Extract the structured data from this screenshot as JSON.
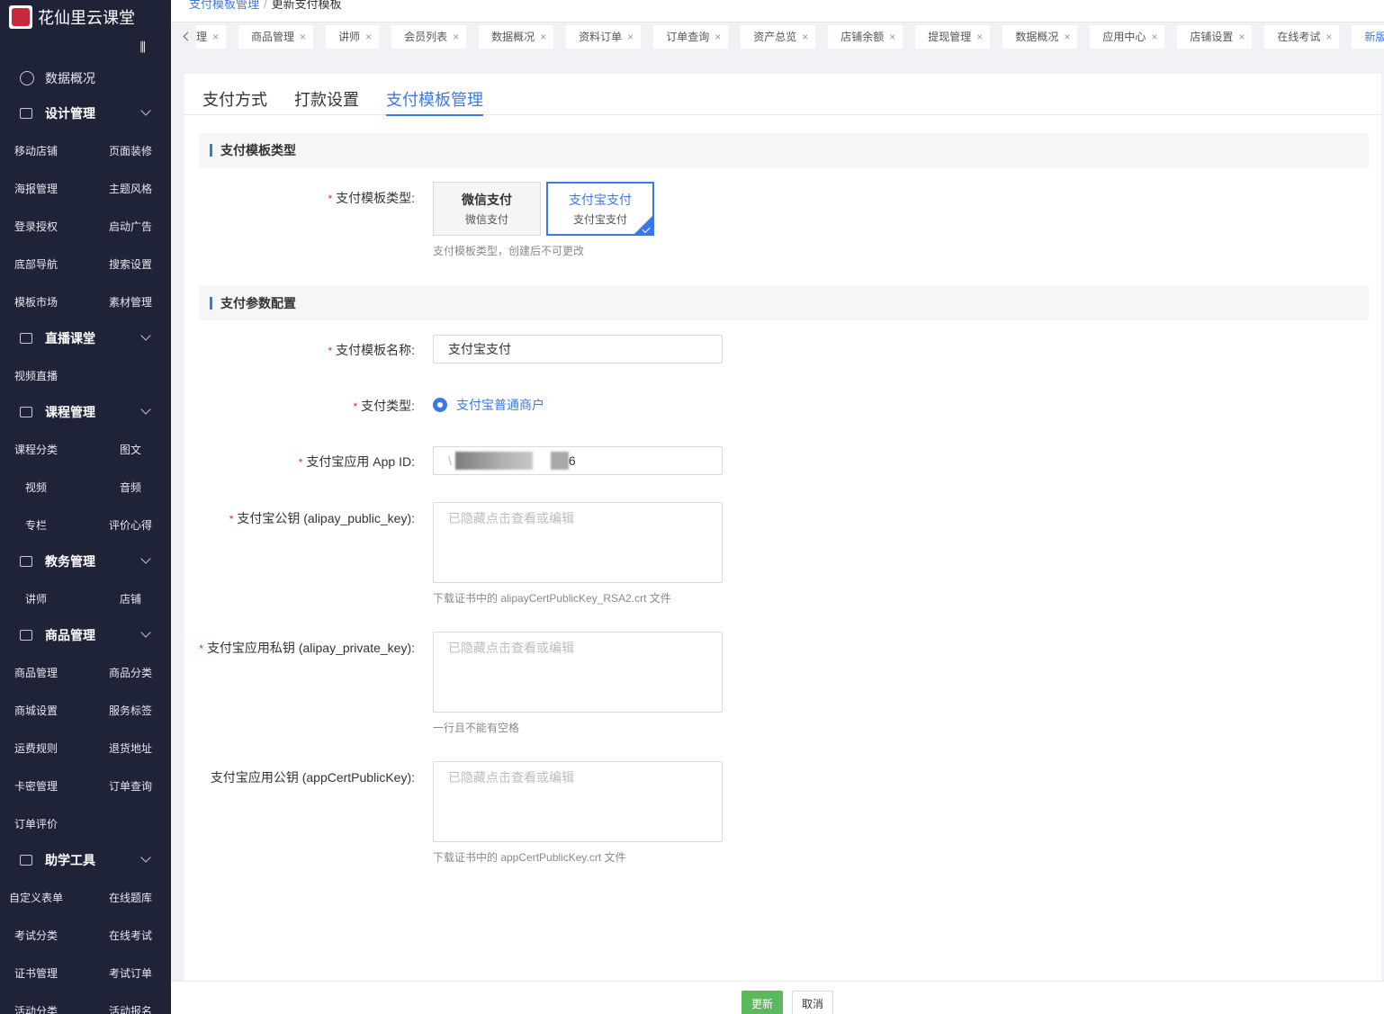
{
  "app": {
    "brand_name": "花仙里云课堂"
  },
  "sidebar": {
    "overview": "数据概况",
    "groups": [
      {
        "title": "设计管理",
        "items": [
          "移动店铺",
          "页面装修",
          "海报管理",
          "主题风格",
          "登录授权",
          "启动广告",
          "底部导航",
          "搜索设置",
          "模板市场",
          "素材管理"
        ]
      },
      {
        "title": "直播课堂",
        "items": [
          "视频直播"
        ]
      },
      {
        "title": "课程管理",
        "items": [
          "课程分类",
          "图文",
          "视频",
          "音频",
          "专栏",
          "评价心得"
        ]
      },
      {
        "title": "教务管理",
        "items": [
          "讲师",
          "店铺"
        ]
      },
      {
        "title": "商品管理",
        "items": [
          "商品管理",
          "商品分类",
          "商城设置",
          "服务标签",
          "运费规则",
          "退货地址",
          "卡密管理",
          "订单查询",
          "订单评价"
        ]
      },
      {
        "title": "助学工具",
        "items": [
          "自定义表单",
          "在线题库",
          "考试分类",
          "在线考试",
          "证书管理",
          "考试订单",
          "活动分类",
          "活动报名"
        ]
      }
    ]
  },
  "breadcrumb": {
    "parent": "支付模板管理",
    "separator": "/",
    "current": "更新支付模板"
  },
  "tabbar": {
    "tabs": [
      "理",
      "商品管理",
      "讲师",
      "会员列表",
      "数据概况",
      "资料订单",
      "订单查询",
      "资产总览",
      "店铺余额",
      "提现管理",
      "数据概况",
      "应用中心",
      "店铺设置",
      "在线考试",
      "新版支"
    ],
    "close_glyph": "×"
  },
  "page_tabs": [
    "支付方式",
    "打款设置",
    "支付模板管理"
  ],
  "section1": {
    "title": "支付模板类型"
  },
  "template_type": {
    "label": "支付模板类型:",
    "options": [
      {
        "title": "微信支付",
        "subtitle": "微信支付",
        "selected": false
      },
      {
        "title": "支付宝支付",
        "subtitle": "支付宝支付",
        "selected": true
      }
    ],
    "hint": "支付模板类型，创建后不可更改"
  },
  "section2": {
    "title": "支付参数配置"
  },
  "form": {
    "name": {
      "label": "支付模板名称:",
      "value": "支付宝支付"
    },
    "pay_type": {
      "label": "支付类型:",
      "value": "支付宝普通商户"
    },
    "app_id": {
      "label": "支付宝应用 App ID:",
      "value_prefix": "\\",
      "value_suffix": "6"
    },
    "public_key": {
      "label": "支付宝公钥 (alipay_public_key):",
      "placeholder": "已隐藏点击查看或编辑",
      "hint": "下载证书中的 alipayCertPublicKey_RSA2.crt 文件"
    },
    "private_key": {
      "label": "支付宝应用私钥 (alipay_private_key):",
      "placeholder": "已隐藏点击查看或编辑",
      "hint": "一行且不能有空格"
    },
    "app_cert": {
      "label": "支付宝应用公钥 (appCertPublicKey):",
      "placeholder": "已隐藏点击查看或编辑",
      "hint": "下载证书中的 appCertPublicKey.crt 文件"
    }
  },
  "footer": {
    "submit": "更新",
    "cancel": "取消"
  },
  "colors": {
    "sidebar_bg": "#1f2338",
    "accent": "#3b78e7",
    "submit_bg": "#5cb85c",
    "required": "#f5222d"
  }
}
